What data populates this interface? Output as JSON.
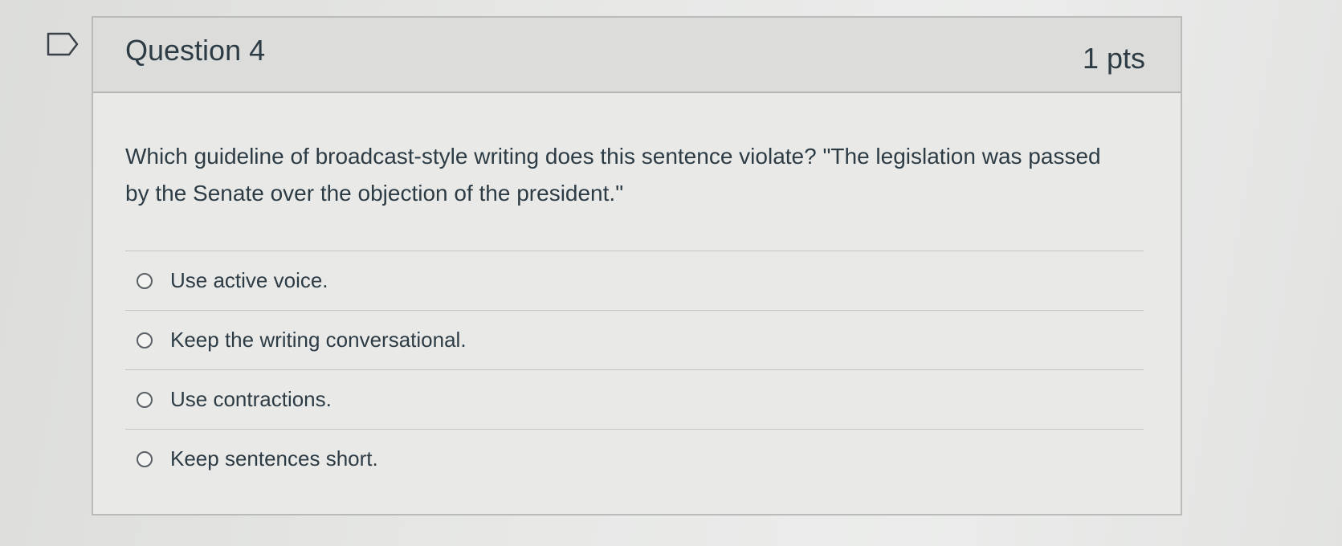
{
  "question": {
    "title": "Question 4",
    "points": "1 pts",
    "text": "Which guideline of broadcast-style writing does this sentence violate? \"The legislation was passed by the Senate over the objection of the president.\"",
    "flag_icon": "flag-outline-icon"
  },
  "answers": [
    {
      "label": "Use active voice."
    },
    {
      "label": "Keep the writing conversational."
    },
    {
      "label": "Use contractions."
    },
    {
      "label": "Keep sentences short."
    }
  ]
}
